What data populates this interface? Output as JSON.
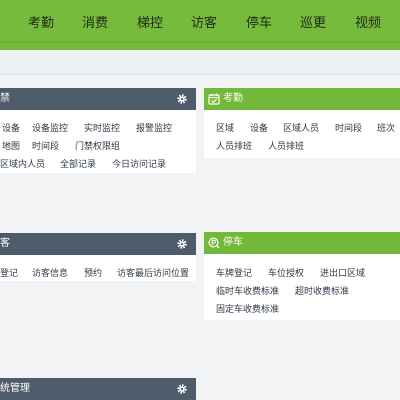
{
  "nav": {
    "items": [
      "考勤",
      "消费",
      "梯控",
      "访客",
      "停车",
      "巡更",
      "视频"
    ]
  },
  "colors": {
    "brand_green": "#77bb3c",
    "panel_dark_header": "#4e5b6b",
    "panel_green_header": "#74b83a"
  },
  "panels": {
    "door": {
      "title": "禁",
      "icon": "gear-icon",
      "links": [
        "设备",
        "设备监控",
        "实时监控",
        "报警监控",
        "地图",
        "时间段",
        "门禁权限组",
        "区域内人员",
        "全部记录",
        "今日访问记录"
      ]
    },
    "attendance": {
      "title": "考勤",
      "icon": "calendar-check-icon",
      "links": [
        "区域",
        "设备",
        "区域人员",
        "时间段",
        "班次",
        "人员排班",
        "人员排班"
      ]
    },
    "visitor": {
      "title": "客",
      "icon": "gear-icon",
      "links": [
        "登记",
        "访客信息",
        "预约",
        "访客最后访问位置"
      ]
    },
    "parking": {
      "title": "停车",
      "icon": "parking-icon",
      "links": [
        "车牌登记",
        "车位授权",
        "进出口区域",
        "临时车收费标准",
        "超时收费标准",
        "固定车收费标准"
      ]
    },
    "system": {
      "title": "统管理",
      "icon": "gear-icon"
    }
  }
}
